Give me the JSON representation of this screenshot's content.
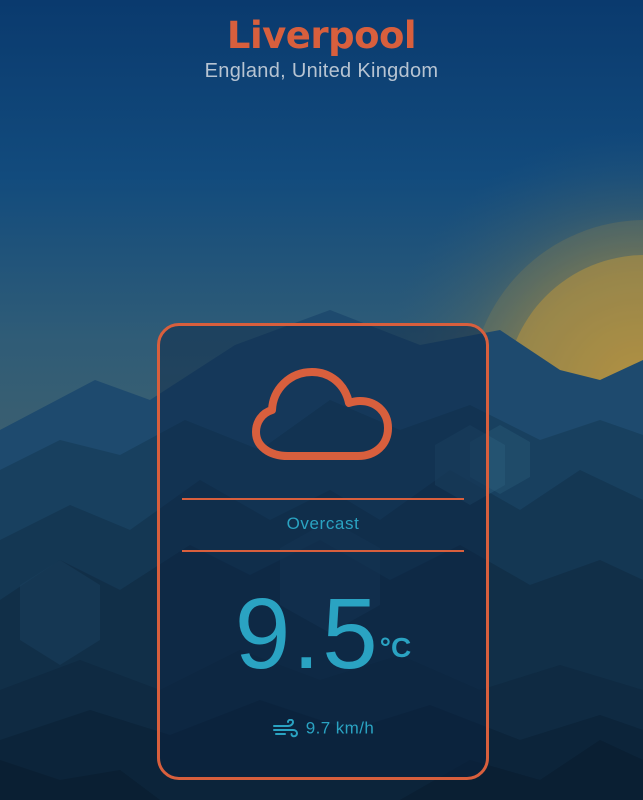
{
  "location": {
    "city": "Liverpool",
    "region": "England, United Kingdom"
  },
  "weather": {
    "condition": "Overcast",
    "icon": "cloud-icon",
    "temperature": "9.5",
    "unit": "°C",
    "wind_icon": "wind-icon",
    "wind_speed": "9.7 km/h"
  },
  "colors": {
    "accent": "#d85f3d",
    "text_primary": "#2aa3c2",
    "text_secondary": "#b7c4d2",
    "sky_top": "#0c3b6c",
    "sun": "#c7a24a"
  }
}
